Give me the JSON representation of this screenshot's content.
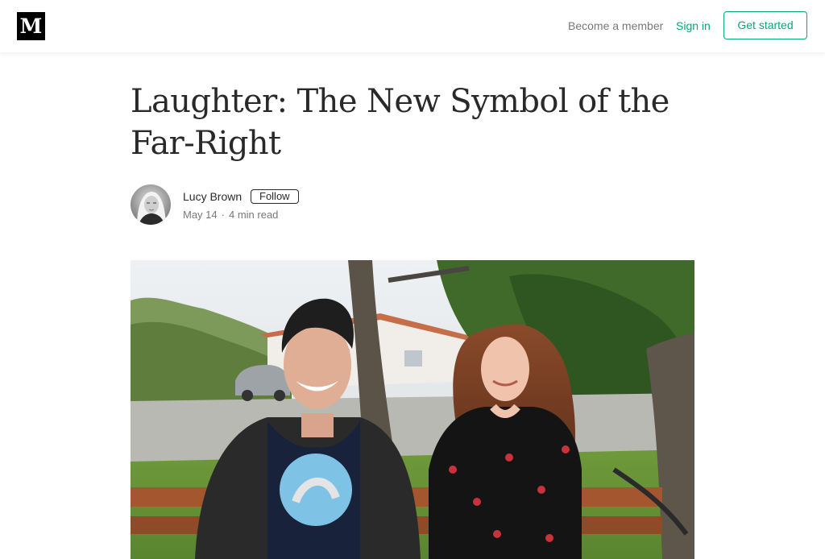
{
  "header": {
    "logo_letter": "M",
    "become_member": "Become a member",
    "sign_in": "Sign in",
    "get_started": "Get started",
    "accent_color": "#03a87c"
  },
  "article": {
    "title": "Laughter: The New Symbol of the Far-Right",
    "author": {
      "name": "Lucy Brown",
      "follow_label": "Follow",
      "avatar_icon": "author-avatar-photo"
    },
    "date": "May 14",
    "separator": "·",
    "read_time": "4 min read",
    "hero_image": "photo-two-people-laughing-on-bench"
  }
}
